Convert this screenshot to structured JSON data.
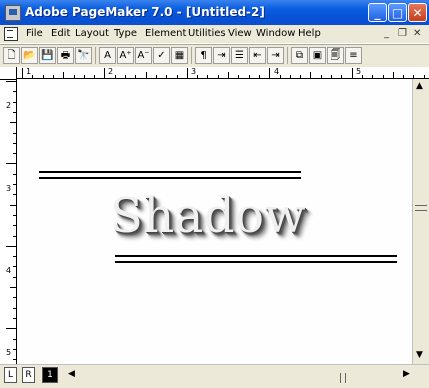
{
  "window": {
    "title": "Adobe PageMaker 7.0 - [Untitled-2]",
    "buttons": {
      "minimize": "_",
      "maximize": "□",
      "close": "✕"
    }
  },
  "menubar": {
    "items": [
      "File",
      "Edit",
      "Layout",
      "Type",
      "Element",
      "Utilities",
      "View",
      "Window",
      "Help"
    ],
    "mdi": {
      "minimize": "_",
      "restore": "❐",
      "close": "✕"
    }
  },
  "toolbar": {
    "buttons": [
      {
        "name": "new",
        "glyph": "🗋"
      },
      {
        "name": "open",
        "glyph": "📂"
      },
      {
        "name": "save",
        "glyph": "💾"
      },
      {
        "name": "print",
        "glyph": "🖶"
      },
      {
        "name": "find",
        "glyph": "🔭"
      },
      {
        "name": "sep"
      },
      {
        "name": "text-tool",
        "glyph": "A"
      },
      {
        "name": "font-larger",
        "glyph": "A⁺"
      },
      {
        "name": "font-smaller",
        "glyph": "A⁻"
      },
      {
        "name": "spelling",
        "glyph": "✓"
      },
      {
        "name": "image",
        "glyph": "▦"
      },
      {
        "name": "sep"
      },
      {
        "name": "paragraph",
        "glyph": "¶"
      },
      {
        "name": "tab",
        "glyph": "⇥"
      },
      {
        "name": "bullets",
        "glyph": "☰"
      },
      {
        "name": "indent-left",
        "glyph": "⇤"
      },
      {
        "name": "indent-right",
        "glyph": "⇥"
      },
      {
        "name": "sep"
      },
      {
        "name": "frame",
        "glyph": "⧉"
      },
      {
        "name": "group",
        "glyph": "▣"
      },
      {
        "name": "story",
        "glyph": "🗐"
      },
      {
        "name": "layers",
        "glyph": "≡"
      }
    ]
  },
  "ruler": {
    "horizontal_labels": [
      "1",
      "2",
      "3",
      "4",
      "5"
    ],
    "vertical_labels": [
      "2",
      "3",
      "4",
      "5"
    ]
  },
  "canvas": {
    "text": "Shadow"
  },
  "bottombar": {
    "tabs": [
      "L",
      "R",
      "1"
    ],
    "left_arrow": "◀",
    "right_arrow": "▶"
  },
  "vscroll": {
    "up_arrow": "▲",
    "down_arrow": "▼"
  }
}
